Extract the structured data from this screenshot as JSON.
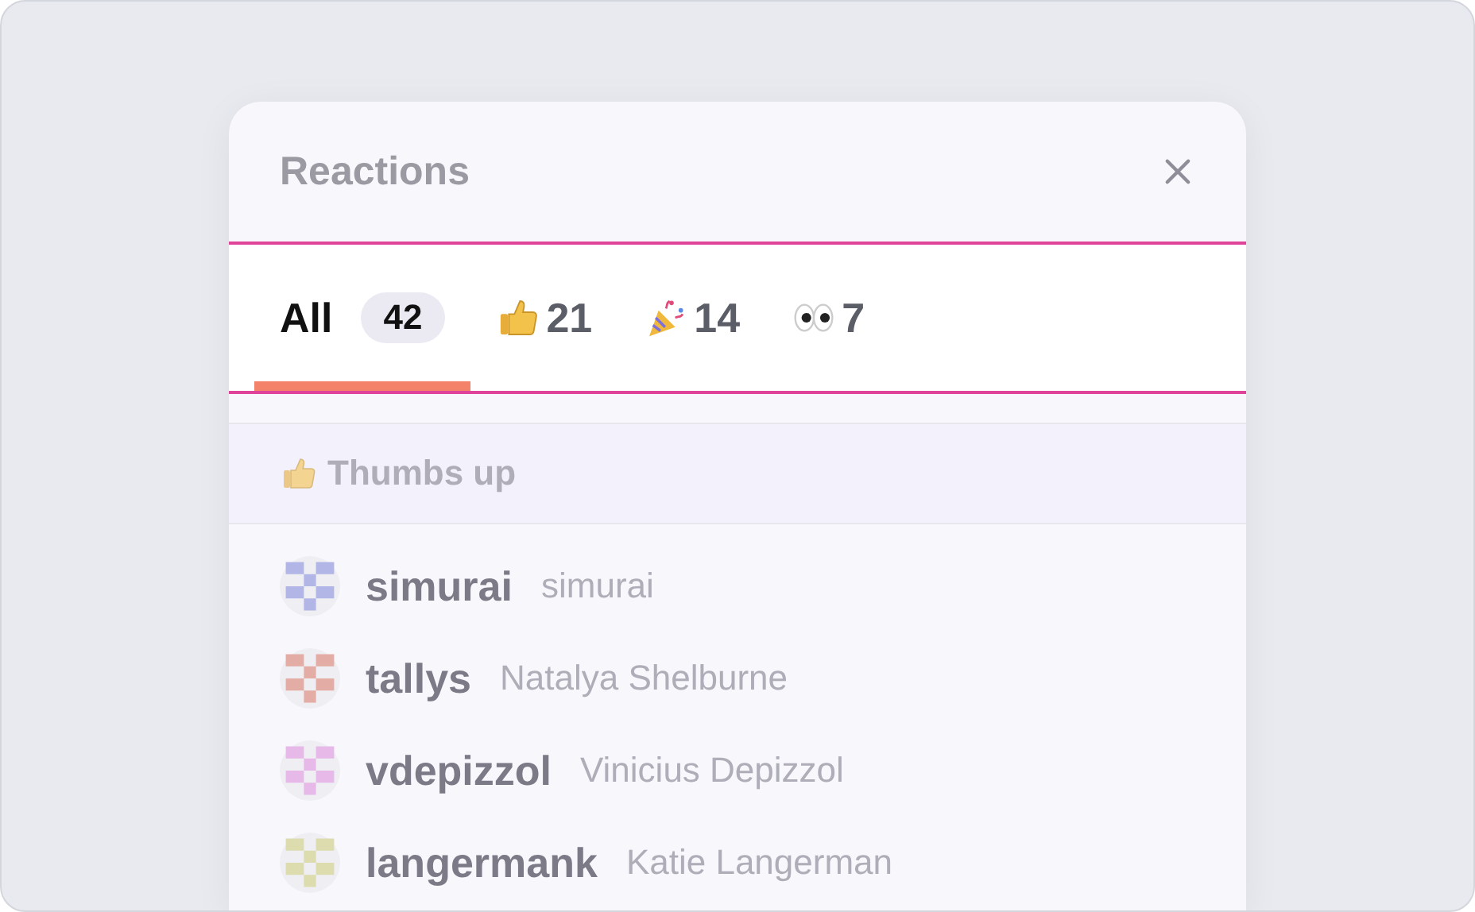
{
  "dialog": {
    "title": "Reactions"
  },
  "tabs": [
    {
      "kind": "text",
      "label": "All",
      "count": "42",
      "selected": true
    },
    {
      "kind": "thumbs",
      "count": "21",
      "selected": false
    },
    {
      "kind": "party",
      "count": "14",
      "selected": false
    },
    {
      "kind": "eyes",
      "count": "7",
      "selected": false
    }
  ],
  "section": {
    "kind": "thumbs",
    "title": "Thumbs up"
  },
  "users": [
    {
      "username": "simurai",
      "name": "simurai",
      "color": "#b1b6e6"
    },
    {
      "username": "tallys",
      "name": "Natalya Shelburne",
      "color": "#e3aca4"
    },
    {
      "username": "vdepizzol",
      "name": "Vinicius Depizzol",
      "color": "#e6b9e8"
    },
    {
      "username": "langermank",
      "name": "Katie Langerman",
      "color": "#dcdcae"
    }
  ]
}
